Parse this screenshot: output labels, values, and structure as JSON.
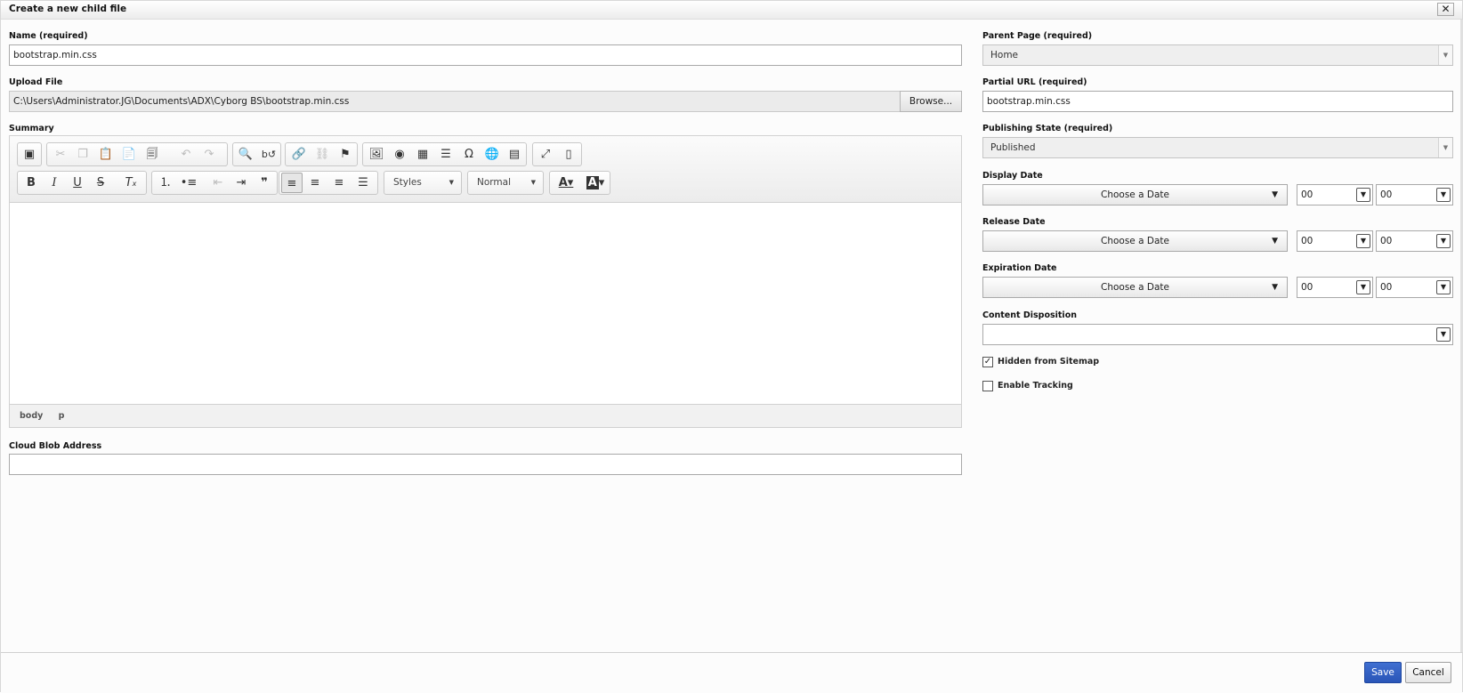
{
  "dialog": {
    "title": "Create a new child file",
    "close_glyph": "✕"
  },
  "left": {
    "name_label": "Name (required)",
    "name_value": "bootstrap.min.css",
    "upload_label": "Upload File",
    "upload_value": "C:\\Users\\Administrator.JG\\Documents\\ADX\\Cyborg BS\\bootstrap.min.css",
    "browse_label": "Browse...",
    "summary_label": "Summary",
    "cloud_label": "Cloud Blob Address",
    "cloud_value": ""
  },
  "editor": {
    "styles_combo": "Styles",
    "format_combo": "Normal",
    "path": [
      "body",
      "p"
    ]
  },
  "right": {
    "parent_label": "Parent Page (required)",
    "parent_value": "Home",
    "partial_label": "Partial URL (required)",
    "partial_value": "bootstrap.min.css",
    "state_label": "Publishing State (required)",
    "state_value": "Published",
    "display_label": "Display Date",
    "release_label": "Release Date",
    "expiration_label": "Expiration Date",
    "choose_date": "Choose a Date",
    "hour": "00",
    "minute": "00",
    "disposition_label": "Content Disposition",
    "disposition_value": "",
    "hidden_label": "Hidden from Sitemap",
    "hidden_checked": true,
    "tracking_label": "Enable Tracking",
    "tracking_checked": false
  },
  "footer": {
    "save_label": "Save",
    "cancel_label": "Cancel"
  },
  "colors": {
    "primary": "#2f5fc4",
    "border": "#a9a9a9"
  }
}
